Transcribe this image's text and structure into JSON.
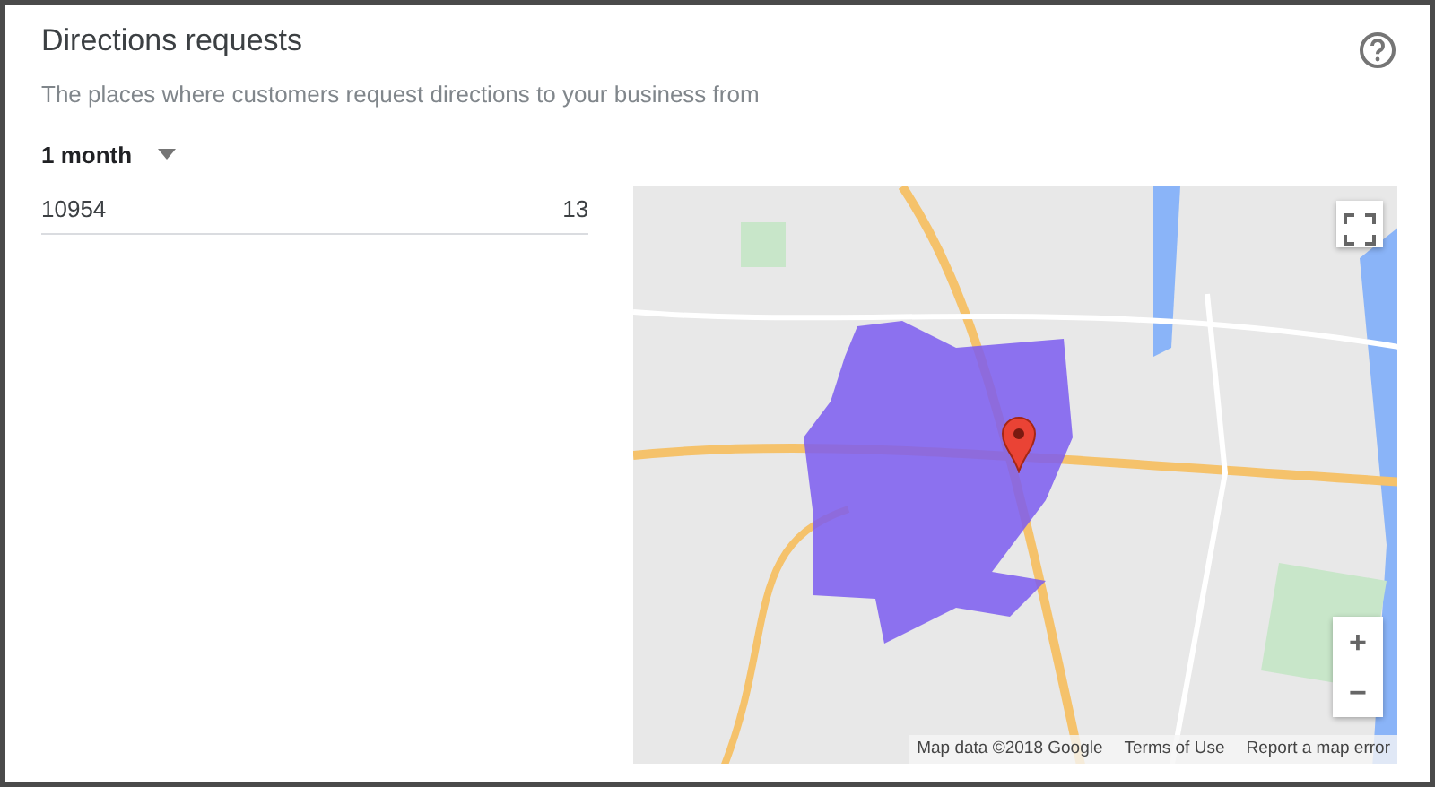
{
  "header": {
    "title": "Directions requests",
    "subtitle": "The places where customers request directions to your business from"
  },
  "period": {
    "value": "1 month"
  },
  "rows": [
    {
      "label": "10954",
      "count": "13"
    }
  ],
  "map": {
    "attribution": "Map data ©2018 Google",
    "links": [
      "Terms of Use",
      "Report a map error"
    ],
    "zoom_in": "+",
    "zoom_out": "−"
  }
}
